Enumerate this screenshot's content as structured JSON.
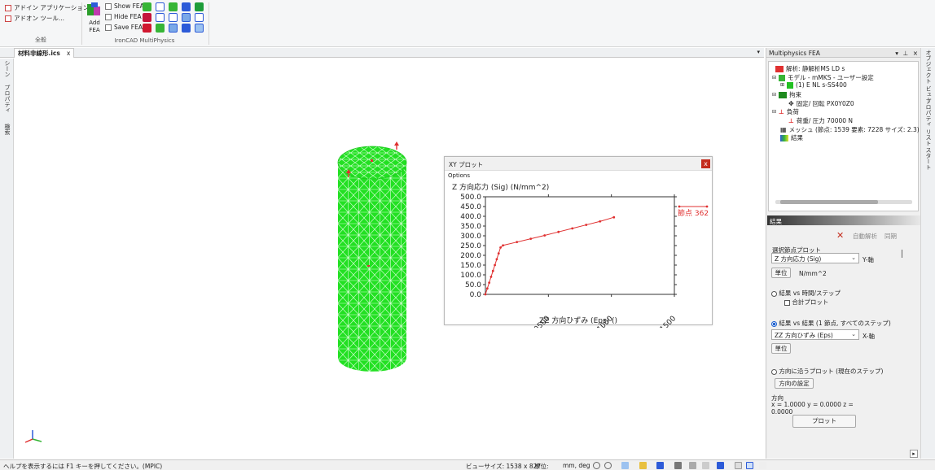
{
  "ribbon": {
    "group_general": {
      "label": "全般",
      "items": [
        "アドイン アプリケーション...",
        "アドオン ツール..."
      ]
    },
    "group_multiphysics": {
      "label": "IronCAD MultiPhysics",
      "add_fea_line1": "Add",
      "add_fea_line2": "FEA",
      "show_fea": "Show FEA",
      "hide_fea": "Hide FEA",
      "save_fea": "Save FEA"
    }
  },
  "document_tab": {
    "label": "材料非線形.ics",
    "close": "x"
  },
  "left_tabs": [
    "シーン",
    "プロパティ",
    "検索"
  ],
  "xy_plot": {
    "title": "XY プロット",
    "close": "x",
    "menu": "Options",
    "chart_data": {
      "type": "line",
      "ylabel": "Z 方向応力 (Sig) (N/mm^2)",
      "xlabel": "ZZ 方向ひずみ (Eps) ()",
      "ylim": [
        0,
        500
      ],
      "xlim": [
        0,
        0.015
      ],
      "yticks": [
        "500.0",
        "450.0",
        "400.0",
        "350.0",
        "300.0",
        "250.0",
        "200.0",
        "150.0",
        "100.0",
        "50.0",
        "0.0"
      ],
      "xticks": [
        "0.00500",
        "0.01000",
        "0.01500"
      ],
      "series": [
        {
          "name": "節点 362",
          "color": "#e03030",
          "x": [
            0.0,
            0.00015,
            0.0003,
            0.00045,
            0.0006,
            0.00075,
            0.0009,
            0.00105,
            0.0012,
            0.0014,
            0.0025,
            0.0036,
            0.0047,
            0.0058,
            0.0069,
            0.008,
            0.0091,
            0.0102
          ],
          "y": [
            0,
            30,
            60,
            90,
            120,
            150,
            180,
            210,
            240,
            251,
            268,
            285,
            302,
            320,
            338,
            356,
            374,
            395
          ]
        }
      ],
      "grid": false,
      "legend": "right"
    }
  },
  "right_panel": {
    "title": "Multiphysics FEA",
    "title_controls": [
      "▾",
      "⊥",
      "×"
    ],
    "tree": {
      "analysis": "解析: 静解析MS LD s",
      "model": "モデル - mMKS - ユーザー設定",
      "part": "(1)   E NL s-SS400",
      "constraint": "拘束",
      "constraint_item": "固定/ 回転 PX0Y0Z0",
      "load": "負荷",
      "load_item": "荷重/ 圧力 70000 N",
      "mesh": "メッシュ (節点: 1539   要素: 7228   サイズ: 2.3) mm",
      "results": "結果"
    },
    "results_header": "結果",
    "auto_analysis": "自動解析",
    "sync": "同期",
    "select_node_plot": "選択節点プロット",
    "y_select": "Z 方向応力 (Sig)",
    "y_axis": "Y-軸",
    "unit_button": "単位",
    "unit_value": "N/mm^2",
    "radio_time": "結果 vs 時間/ステップ",
    "check_total": "合計プロット",
    "radio_result": "結果 vs 結果 (1 節点, すべてのステップ)",
    "x_select": "ZZ 方向ひずみ (Eps)",
    "x_axis": "X-軸",
    "unit_button2": "単位",
    "radio_direction": "方向に沿うプロット (現在のステップ)",
    "direction_settings": "方向の設定",
    "direction_label": "方向",
    "direction_values": "x =    1.0000  y =    0.0000  z =",
    "direction_values2": "0.0000",
    "plot_button": "プロット"
  },
  "right_tabs": [
    "オブジェクト ビュー",
    "プロパティ リスト",
    "スタート"
  ],
  "statusbar": {
    "help": "ヘルプを表示するには F1 キーを押してください。(MPIC)",
    "view_size": "ビューサイズ: 1538 x  827",
    "unit_label": "単位:",
    "unit_value": "mm, deg"
  },
  "colors": {
    "mesh_green": "#22e022",
    "plot_red": "#e03030",
    "accent_blue": "#1a5fd0"
  }
}
